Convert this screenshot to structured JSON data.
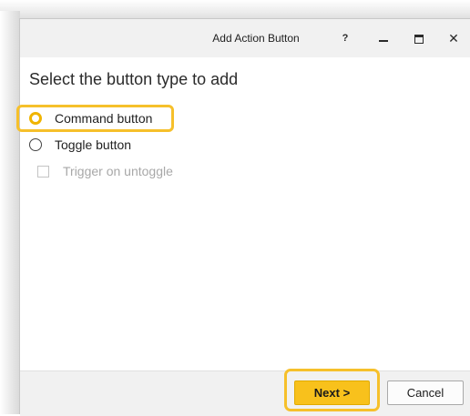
{
  "window": {
    "title": "Add Action Button",
    "help_label": "?"
  },
  "main": {
    "heading": "Select the button type to add",
    "options": [
      {
        "label": "Command button",
        "selected": true
      },
      {
        "label": "Toggle button",
        "selected": false
      }
    ],
    "trigger_checkbox": {
      "label": "Trigger on untoggle",
      "checked": false,
      "enabled": false
    }
  },
  "footer": {
    "next_label": "Next >",
    "cancel_label": "Cancel"
  },
  "colors": {
    "accent": "#f8c11c",
    "highlight_outline": "#f6c02b",
    "titlebar_bg": "#f1f1f1",
    "disabled_text": "#a8a8a8"
  },
  "icons": {
    "minimize": "minimize-icon",
    "maximize": "maximize-icon",
    "close": "close-icon",
    "radio_selected": "radio-checked-icon",
    "radio_unselected": "radio-unchecked-icon",
    "checkbox": "checkbox-icon"
  }
}
